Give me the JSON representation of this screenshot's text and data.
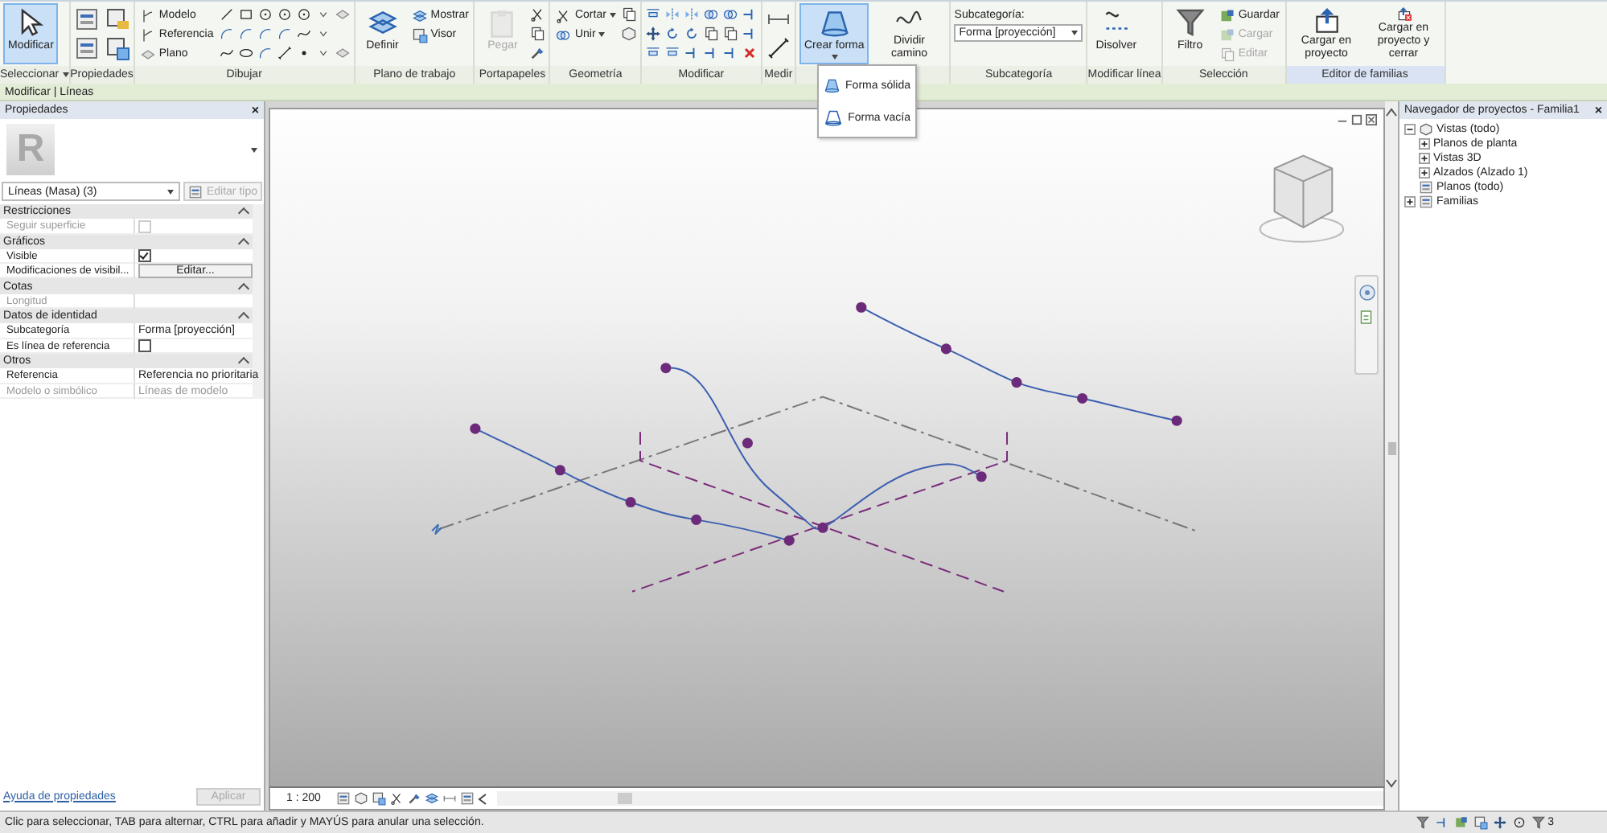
{
  "ribbon": {
    "panels": [
      {
        "label": "Seleccionar",
        "has_menu": true,
        "tools": [
          {
            "kind": "big",
            "label": "Modificar",
            "selected": true
          }
        ]
      },
      {
        "label": "Propiedades"
      },
      {
        "label": "Dibujar",
        "tools": [
          {
            "kind": "stack",
            "items": [
              {
                "label": "Modelo"
              },
              {
                "label": "Referencia"
              },
              {
                "label": "Plano"
              }
            ]
          }
        ]
      },
      {
        "label": "Plano de trabajo",
        "tools": [
          {
            "kind": "big",
            "label": "Definir",
            "selected": false
          },
          {
            "kind": "stack",
            "items": [
              {
                "label": "Mostrar"
              },
              {
                "label": "Visor"
              }
            ]
          }
        ]
      },
      {
        "label": "Portapapeles",
        "tools": [
          {
            "kind": "big",
            "label": "Pegar",
            "selected": false,
            "disabled": true
          }
        ]
      },
      {
        "label": "Geometría",
        "tools": [
          {
            "kind": "stack",
            "items": [
              {
                "label": "Cortar",
                "has_menu": true
              },
              {
                "label": "Unir",
                "has_menu": true
              }
            ]
          }
        ]
      },
      {
        "label": "Modificar"
      },
      {
        "label": "Medir"
      },
      {
        "tools": [
          {
            "kind": "big",
            "label": "Crear forma",
            "selected": true,
            "has_menu": true
          },
          {
            "kind": "big",
            "label": "Dividir camino",
            "selected": false
          }
        ]
      },
      {
        "label": "Subcategoría",
        "tools": [
          {
            "kind": "combo",
            "label": "Subcategoría:",
            "value": "Forma [proyección]"
          }
        ]
      },
      {
        "label": "Modificar línea",
        "tools": [
          {
            "kind": "big",
            "label": "Disolver",
            "selected": false
          }
        ]
      },
      {
        "label": "Selección",
        "tools": [
          {
            "kind": "big",
            "label": "Filtro",
            "selected": false
          },
          {
            "kind": "stack",
            "items": [
              {
                "label": "Guardar"
              },
              {
                "label": "Cargar",
                "disabled": true
              },
              {
                "label": "Editar",
                "disabled": true
              }
            ]
          }
        ]
      },
      {
        "label": "Editor de familias",
        "highlighted": true,
        "tools": [
          {
            "kind": "big",
            "label": "Cargar en proyecto",
            "selected": false
          },
          {
            "kind": "big",
            "label": "Cargar en proyecto y cerrar",
            "selected": false
          }
        ]
      }
    ]
  },
  "dropdown": {
    "items": [
      {
        "label": "Forma sólida"
      },
      {
        "label": "Forma vacía"
      }
    ]
  },
  "context_bar": {
    "title": "Modificar | Líneas"
  },
  "properties": {
    "title": "Propiedades",
    "close": "×",
    "preview_letter": "R",
    "type_selector": "Líneas (Masa) (3)",
    "edit_type": {
      "label": "Editar tipo",
      "disabled": true
    },
    "groups": [
      {
        "label": "Restricciones",
        "rows": [
          {
            "kind": "checkbox",
            "label": "Seguir superficie",
            "checked": false,
            "disabled": true
          }
        ]
      },
      {
        "label": "Gráficos",
        "rows": [
          {
            "kind": "checkbox",
            "label": "Visible",
            "checked": true,
            "disabled": false
          },
          {
            "kind": "button",
            "label": "Modificaciones de visibil...",
            "value": "Editar...",
            "disabled": false
          }
        ]
      },
      {
        "label": "Cotas",
        "rows": [
          {
            "kind": "text",
            "label": "Longitud",
            "disabled": true
          }
        ]
      },
      {
        "label": "Datos de identidad",
        "rows": [
          {
            "kind": "text",
            "label": "Subcategoría",
            "value": "Forma [proyección]",
            "disabled": false
          },
          {
            "kind": "checkbox",
            "label": "Es línea de referencia",
            "checked": false,
            "disabled": false
          }
        ]
      },
      {
        "label": "Otros",
        "rows": [
          {
            "kind": "text",
            "label": "Referencia",
            "value": "Referencia no prioritaria",
            "disabled": false
          },
          {
            "kind": "text",
            "label": "Modelo o simbólico",
            "value": "Líneas de modelo",
            "disabled": true
          }
        ]
      }
    ],
    "help_link": "Ayuda de propiedades",
    "apply": {
      "label": "Aplicar",
      "disabled": true
    }
  },
  "view": {
    "scale": "1 : 200"
  },
  "browser": {
    "title": "Navegador de proyectos - Familia1",
    "close": "×",
    "tree": [
      {
        "label": "Vistas (todo)",
        "expanded": true,
        "children": [
          {
            "label": "Planos de planta",
            "expanded": false
          },
          {
            "label": "Vistas 3D",
            "expanded": false
          },
          {
            "label": "Alzados (Alzado 1)",
            "expanded": false
          }
        ]
      },
      {
        "label": "Planos (todo)"
      },
      {
        "label": "Familias",
        "expanded": false
      }
    ]
  },
  "status_bar": {
    "message": "Clic para seleccionar, TAB para alternar, CTRL para añadir y MAYÚS para anular una selección.",
    "filter_count": "3"
  }
}
